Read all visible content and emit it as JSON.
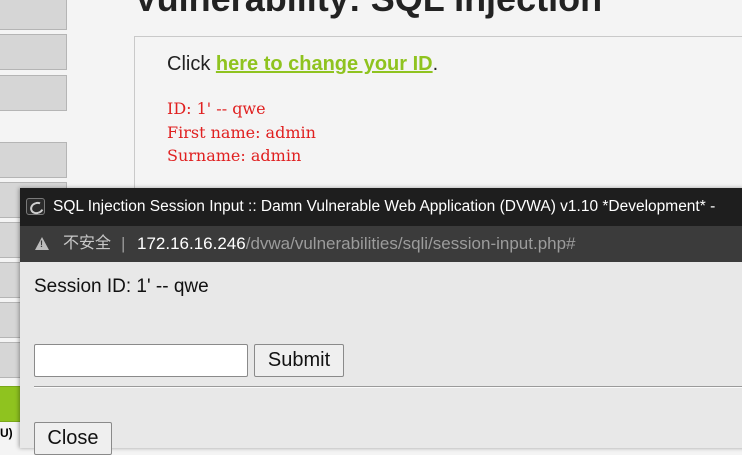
{
  "page": {
    "title": "Vulnerability: SQL Injection",
    "click_prefix": "Click ",
    "click_link": "here to change your ID",
    "click_suffix": ".",
    "result": {
      "id_line": "ID: 1' -- qwe",
      "first_name_line": "First name: admin",
      "surname_line": "Surname: admin"
    },
    "menu_cut_text": "U)"
  },
  "popup": {
    "window_title": "SQL Injection Session Input :: Damn Vulnerable Web Application (DVWA) v1.10 *Development* - ",
    "address": {
      "insecure_label": "不安全",
      "separator": "|",
      "host": "172.16.16.246",
      "path": "/dvwa/vulnerabilities/sqli/session-input.php#"
    },
    "session_text": "Session ID: 1' -- qwe",
    "input_value": "",
    "submit_label": "Submit",
    "close_label": "Close"
  },
  "colors": {
    "accent_green": "#8fc31f",
    "result_red": "#e02020",
    "titlebar_bg": "#1e1e1e",
    "addressbar_bg": "#3b3b3b"
  },
  "icons": {
    "app": "dvwa-window-icon",
    "address": "warning-icon"
  }
}
